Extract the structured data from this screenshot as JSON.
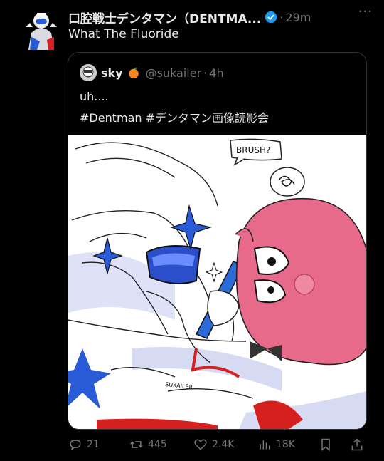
{
  "tweet": {
    "author_name": "口腔戦士デンタマン（DENTMA...",
    "time": "29m",
    "text": "What The Fluoride",
    "more_icon": "ellipsis-icon"
  },
  "quoted": {
    "author_name": "sky",
    "handle": "@sukailer",
    "time": "4h",
    "line1": "uh....",
    "line2": "#Dentman #デンタマン画像読影会",
    "image_text": {
      "speech": "BRUSH?",
      "signature": "SUKAILER"
    }
  },
  "actions": {
    "replies": "21",
    "reposts": "445",
    "likes": "2.4K",
    "views": "18K"
  },
  "colors": {
    "accent": "#1d9bf0",
    "muted": "#71767b",
    "text": "#e7e9ea",
    "pink": "#e86a8a",
    "blue": "#2a5bd7",
    "red": "#d62020"
  }
}
